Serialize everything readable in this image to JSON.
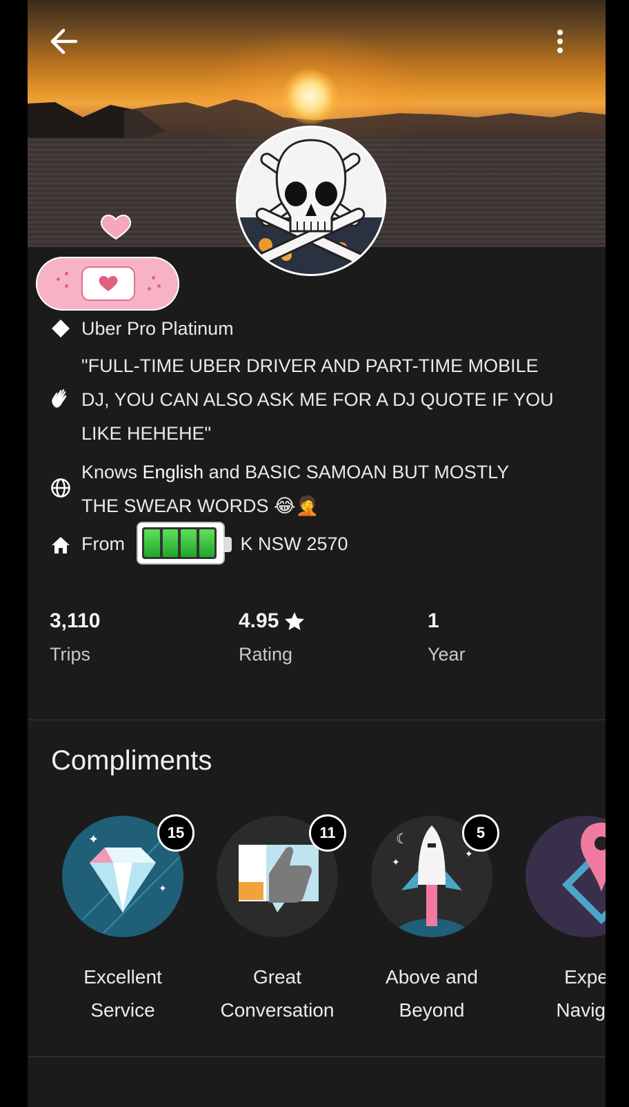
{
  "profile": {
    "tier": "Uber Pro Platinum",
    "bio": "\"FULL-TIME UBER DRIVER AND PART-TIME MOBILE DJ, YOU CAN ALSO ASK ME FOR A DJ QUOTE IF YOU LIKE HEHEHE\"",
    "languages_prefix": "Knows ",
    "languages_main": "English",
    "languages_rest": " and BASIC SAMOAN BUT MOSTLY THE SWEAR WORDS 😂🤦",
    "from_prefix": "From ",
    "from_visible": "K NSW 2570"
  },
  "stats": [
    {
      "value": "3,110",
      "label": "Trips"
    },
    {
      "value": "4.95",
      "label": "Rating",
      "icon": "star-icon"
    },
    {
      "value": "1",
      "label": "Year"
    }
  ],
  "compliments": {
    "title": "Compliments",
    "items": [
      {
        "count": "15",
        "line1": "Excellent",
        "line2": "Service",
        "icon": "diamond-icon"
      },
      {
        "count": "11",
        "line1": "Great",
        "line2": "Conversation",
        "icon": "thumbs-up-icon"
      },
      {
        "count": "5",
        "line1": "Above and",
        "line2": "Beyond",
        "icon": "rocket-icon"
      },
      {
        "count": "",
        "line1": "Expe",
        "line2": "Naviga",
        "icon": "map-pin-icon"
      }
    ]
  },
  "icons": {
    "back": "back-arrow-icon",
    "more": "more-vertical-icon",
    "tier": "diamond-icon",
    "bio": "waving-hand-icon",
    "language": "globe-icon",
    "home": "home-icon"
  },
  "colors": {
    "background": "#1b1b1b",
    "text": "#eaeaea",
    "badge": "#000000"
  }
}
